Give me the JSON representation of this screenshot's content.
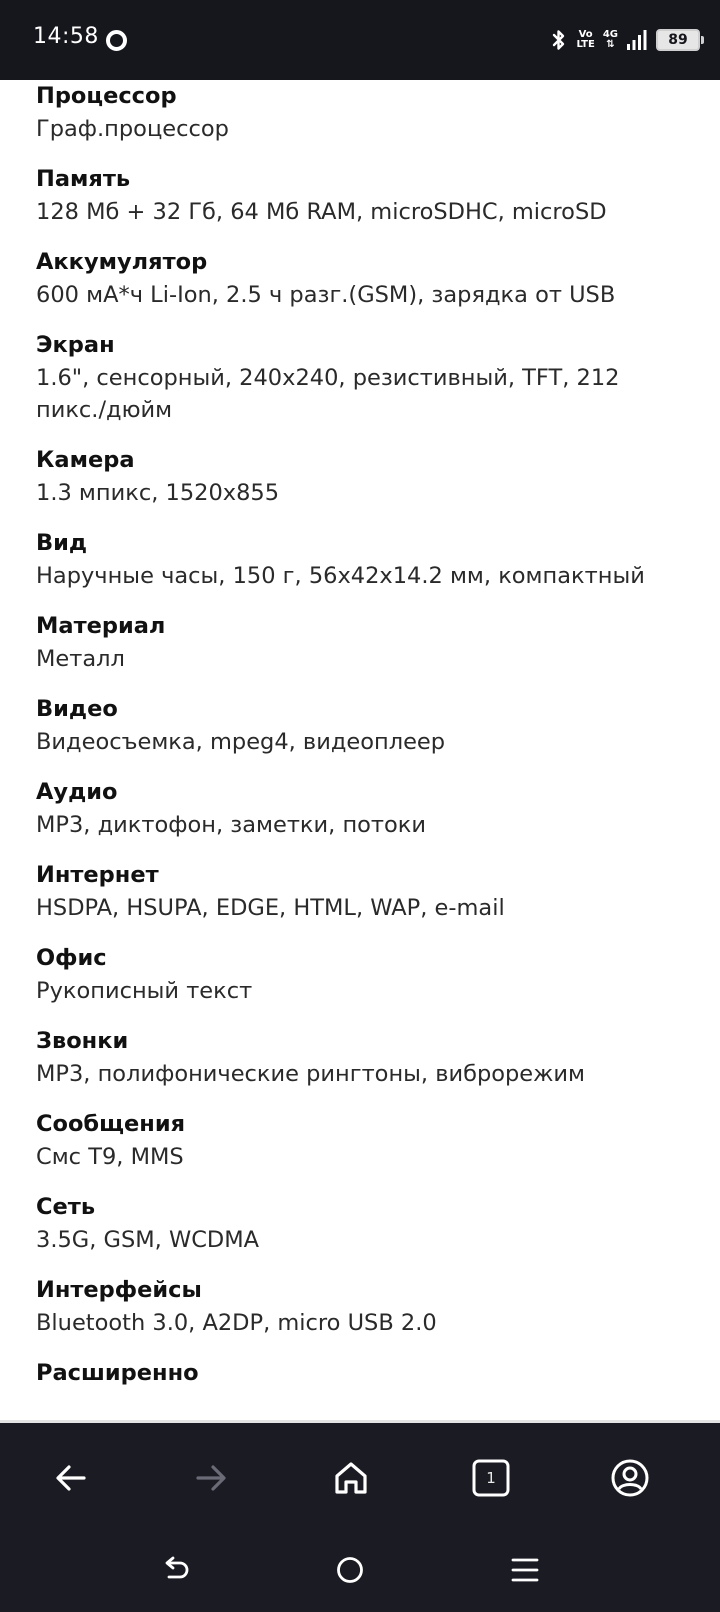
{
  "status_bar": {
    "time": "14:58",
    "volte_top": "Vo",
    "volte_bottom": "LTE",
    "network": "4G",
    "battery": "89"
  },
  "specs": [
    {
      "label": "Процессор",
      "value": "Граф.процессор"
    },
    {
      "label": "Память",
      "value": "128 Мб + 32 Гб, 64 Мб RAM, microSDHC, microSD"
    },
    {
      "label": "Аккумулятор",
      "value": "600 мА*ч Li-Ion, 2.5 ч разг.(GSM), зарядка от USB"
    },
    {
      "label": "Экран",
      "value": "1.6\", сенсорный, 240x240, резистивный, TFT, 212 пикс./дюйм"
    },
    {
      "label": "Камера",
      "value": "1.3 мпикс, 1520x855"
    },
    {
      "label": "Вид",
      "value": "Наручные часы, 150 г, 56x42x14.2 мм, компактный"
    },
    {
      "label": "Материал",
      "value": "Металл"
    },
    {
      "label": "Видео",
      "value": "Видеосъемка, mpeg4, видеоплеер"
    },
    {
      "label": "Аудио",
      "value": "MP3, диктофон, заметки, потоки"
    },
    {
      "label": "Интернет",
      "value": "HSDPA, HSUPA, EDGE, HTML, WAP, e-mail"
    },
    {
      "label": "Офис",
      "value": "Рукописный текст"
    },
    {
      "label": "Звонки",
      "value": "MP3, полифонические рингтоны, виброрежим"
    },
    {
      "label": "Сообщения",
      "value": "Смс T9, MMS"
    },
    {
      "label": "Сеть",
      "value": "3.5G, GSM, WCDMA"
    },
    {
      "label": "Интерфейсы",
      "value": "Bluetooth 3.0, A2DP, micro USB 2.0"
    },
    {
      "label": "Расширенно",
      "value": ""
    }
  ],
  "toolbar": {
    "tabs_count": "1",
    "icons": [
      "back-arrow-icon",
      "forward-arrow-icon",
      "home-icon",
      "tabs-icon",
      "profile-icon"
    ]
  },
  "navbar": {
    "icons": [
      "nav-back-icon",
      "nav-home-icon",
      "nav-menu-icon"
    ]
  },
  "colors": {
    "bar_background": "#16161d",
    "content_background": "#ffffff",
    "forward_disabled": "#6b6b78"
  }
}
